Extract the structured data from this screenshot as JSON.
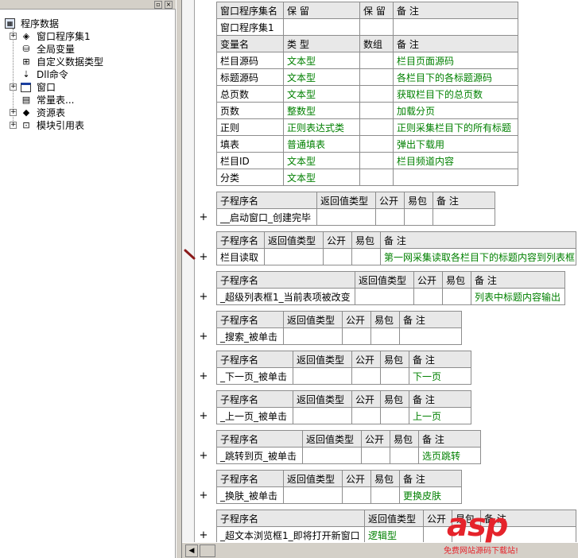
{
  "tree": {
    "root": "程序数据",
    "items": [
      {
        "label": "窗口程序集1",
        "icon": "module-stack-icon",
        "expander": "+"
      },
      {
        "label": "全局变量",
        "icon": "database-icon",
        "expander": ""
      },
      {
        "label": "自定义数据类型",
        "icon": "data-type-icon",
        "expander": ""
      },
      {
        "label": "Dll命令",
        "icon": "dll-command-icon",
        "expander": ""
      },
      {
        "label": "窗口",
        "icon": "window-icon",
        "expander": "+"
      },
      {
        "label": "常量表...",
        "icon": "constant-table-icon",
        "expander": ""
      },
      {
        "label": "资源表",
        "icon": "resource-table-icon",
        "expander": "+"
      },
      {
        "label": "模块引用表",
        "icon": "module-ref-icon",
        "expander": "+"
      }
    ]
  },
  "assembly": {
    "headers": [
      "窗口程序集名",
      "保 留",
      "保 留",
      "备 注"
    ],
    "name": "窗口程序集1",
    "var_headers": [
      "变量名",
      "类 型",
      "数组",
      "备 注"
    ],
    "vars": [
      {
        "name": "栏目源码",
        "type": "文本型",
        "array": "",
        "note": "栏目页面源码"
      },
      {
        "name": "标题源码",
        "type": "文本型",
        "array": "",
        "note": "各栏目下的各标题源码"
      },
      {
        "name": "总页数",
        "type": "文本型",
        "array": "",
        "note": "获取栏目下的总页数"
      },
      {
        "name": "页数",
        "type": "整数型",
        "array": "",
        "note": "加载分页"
      },
      {
        "name": "正则",
        "type": "正则表达式类",
        "array": "",
        "note": "正则采集栏目下的所有标题"
      },
      {
        "name": "填表",
        "type": "普通填表",
        "array": "",
        "note": "弹出下载用"
      },
      {
        "name": "栏目ID",
        "type": "文本型",
        "array": "",
        "note": "栏目频道内容"
      },
      {
        "name": "分类",
        "type": "文本型",
        "array": "",
        "note": ""
      }
    ]
  },
  "sub_headers": [
    "子程序名",
    "返回值类型",
    "公开",
    "易包",
    "备 注"
  ],
  "subs": [
    {
      "name": "__启动窗口_创建完毕",
      "ret": "",
      "pub": "",
      "easy": "",
      "note": ""
    },
    {
      "name": "栏目读取",
      "ret": "",
      "pub": "",
      "easy": "",
      "note": "第一网采集读取各栏目下的标题内容到列表框"
    },
    {
      "name": "_超级列表框1_当前表项被改变",
      "ret": "",
      "pub": "",
      "easy": "",
      "note": "列表中标题内容输出"
    },
    {
      "name": "_搜索_被单击",
      "ret": "",
      "pub": "",
      "easy": "",
      "note": ""
    },
    {
      "name": "_下一页_被单击",
      "ret": "",
      "pub": "",
      "easy": "",
      "note": "下一页"
    },
    {
      "name": "_上一页_被单击",
      "ret": "",
      "pub": "",
      "easy": "",
      "note": "上一页"
    },
    {
      "name": "_跳转到页_被单击",
      "ret": "",
      "pub": "",
      "easy": "",
      "note": "选页跳转"
    },
    {
      "name": "_换肤_被单击",
      "ret": "",
      "pub": "",
      "easy": "",
      "note": "更换皮肤"
    },
    {
      "name": "_超文本浏览框1_即将打开新窗口",
      "ret": "逻辑型",
      "pub": "",
      "easy": "",
      "note": ""
    }
  ],
  "expand_symbol": "+",
  "watermark": {
    "logo": "asp",
    "subtitle": "免费网站源码下载站!"
  }
}
